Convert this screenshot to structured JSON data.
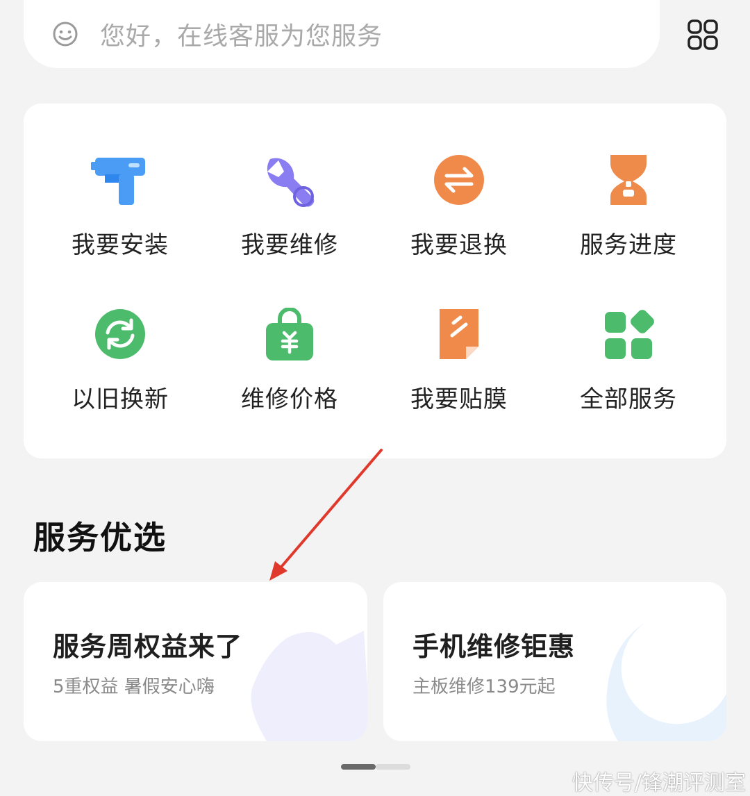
{
  "search": {
    "placeholder": "您好，在线客服为您服务"
  },
  "services": [
    {
      "label": "我要安装",
      "icon": "drill-icon",
      "color": "#4a9cf5"
    },
    {
      "label": "我要维修",
      "icon": "wrench-icon",
      "color": "#8a7df2"
    },
    {
      "label": "我要退换",
      "icon": "exchange-icon",
      "color": "#f08a4b"
    },
    {
      "label": "服务进度",
      "icon": "hourglass-icon",
      "color": "#ee8a4a"
    },
    {
      "label": "以旧换新",
      "icon": "refresh-icon",
      "color": "#4cbb6c"
    },
    {
      "label": "维修价格",
      "icon": "price-bag-icon",
      "color": "#4cbb6c"
    },
    {
      "label": "我要贴膜",
      "icon": "film-icon",
      "color": "#f08a4b"
    },
    {
      "label": "全部服务",
      "icon": "all-services-icon",
      "color": "#4cbb6c"
    }
  ],
  "section": {
    "title": "服务优选"
  },
  "promos": [
    {
      "title": "服务周权益来了",
      "subtitle": "5重权益 暑假安心嗨"
    },
    {
      "title": "手机维修钜惠",
      "subtitle": "主板维修139元起"
    }
  ],
  "watermark": "快传号/锋潮评测室"
}
